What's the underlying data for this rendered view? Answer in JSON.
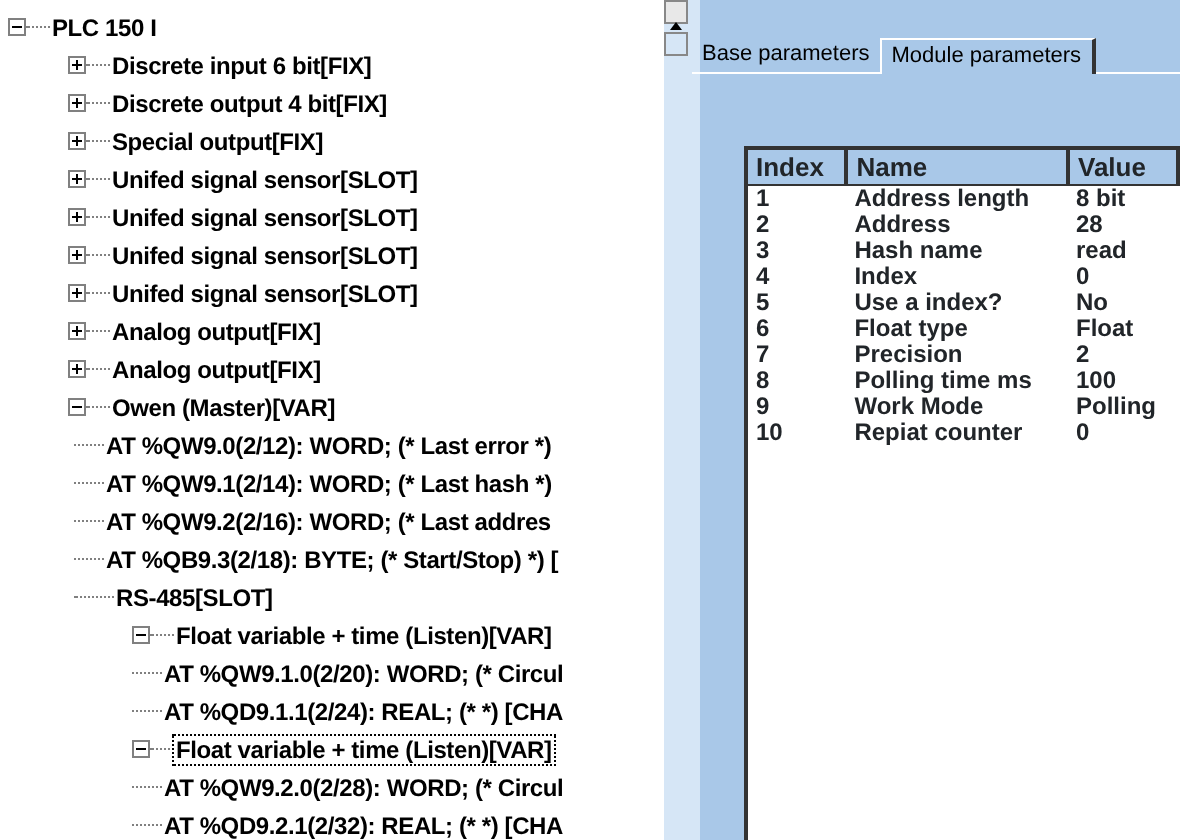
{
  "tree": [
    {
      "label": "PLC 150 I",
      "expanded": true,
      "selected": false,
      "children": [
        {
          "label": "Discrete input 6 bit[FIX]",
          "expanded": false,
          "selected": false
        },
        {
          "label": "Discrete output 4 bit[FIX]",
          "expanded": false,
          "selected": false
        },
        {
          "label": "Special output[FIX]",
          "expanded": false,
          "selected": false
        },
        {
          "label": "Unifed signal sensor[SLOT]",
          "expanded": false,
          "selected": false
        },
        {
          "label": "Unifed signal sensor[SLOT]",
          "expanded": false,
          "selected": false
        },
        {
          "label": "Unifed signal sensor[SLOT]",
          "expanded": false,
          "selected": false
        },
        {
          "label": "Unifed signal sensor[SLOT]",
          "expanded": false,
          "selected": false
        },
        {
          "label": "Analog output[FIX]",
          "expanded": false,
          "selected": false
        },
        {
          "label": "Analog output[FIX]",
          "expanded": false,
          "selected": false
        },
        {
          "label": "Owen (Master)[VAR]",
          "expanded": true,
          "selected": false,
          "children": [
            {
              "label": " AT %QW9.0(2/12): WORD; (* Last error *)",
              "selected": false
            },
            {
              "label": " AT %QW9.1(2/14): WORD; (* Last hash *)",
              "selected": false
            },
            {
              "label": " AT %QW9.2(2/16): WORD; (* Last addres",
              "selected": false
            },
            {
              "label": " AT %QB9.3(2/18): BYTE; (* Start/Stop) *) [",
              "selected": false
            },
            {
              "label": "RS-485[SLOT]",
              "selected": false
            },
            {
              "label": "Float variable + time (Listen)[VAR]",
              "expanded": true,
              "selected": false,
              "children": [
                {
                  "label": " AT %QW9.1.0(2/20): WORD; (* Circul",
                  "selected": false
                },
                {
                  "label": " AT %QD9.1.1(2/24): REAL; (*  *) [CHA",
                  "selected": false
                }
              ]
            },
            {
              "label": "Float variable + time (Listen)[VAR]",
              "expanded": true,
              "selected": true,
              "children": [
                {
                  "label": " AT %QW9.2.0(2/28): WORD; (* Circul",
                  "selected": false
                },
                {
                  "label": " AT %QD9.2.1(2/32): REAL; (*  *) [CHA",
                  "selected": false
                }
              ]
            }
          ]
        }
      ]
    }
  ],
  "tabs": [
    {
      "label": "Base parameters",
      "selected": false
    },
    {
      "label": "Module parameters",
      "selected": true
    }
  ],
  "table": {
    "columns": [
      "Index",
      "Name",
      "Value"
    ],
    "rows": [
      [
        "1",
        "Address length",
        "8 bit"
      ],
      [
        "2",
        "Address",
        "28"
      ],
      [
        "3",
        "Hash name",
        "read"
      ],
      [
        "4",
        "Index",
        "0"
      ],
      [
        "5",
        "Use a index?",
        "No"
      ],
      [
        "6",
        "Float type",
        "Float"
      ],
      [
        "7",
        "Precision",
        "2"
      ],
      [
        "8",
        "Polling time ms",
        "100"
      ],
      [
        "9",
        "Work Mode",
        "Polling"
      ],
      [
        "10",
        "Repiat counter",
        "0"
      ]
    ]
  }
}
